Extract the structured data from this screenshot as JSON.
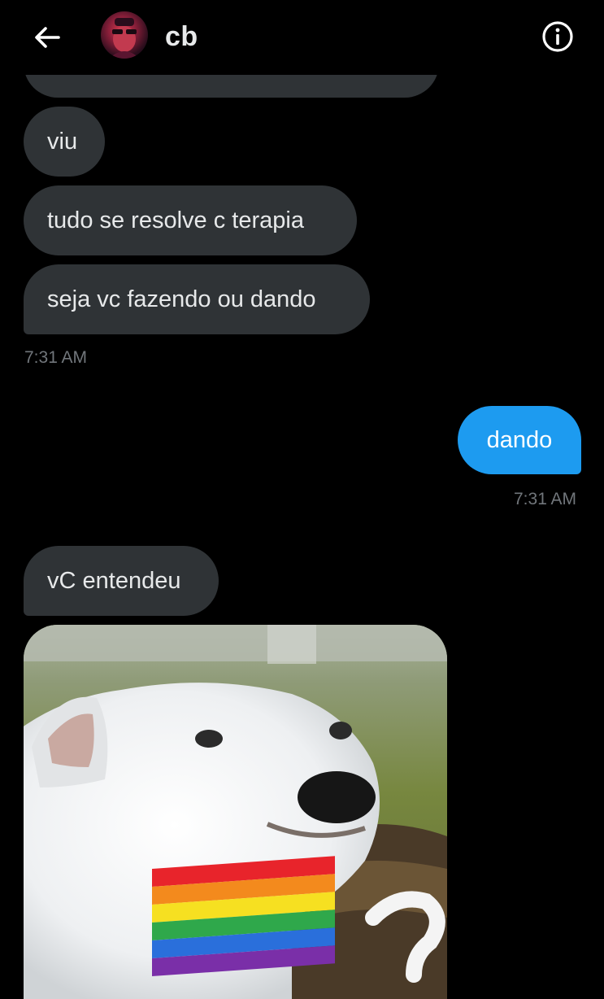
{
  "header": {
    "contact_name": "cb",
    "back_icon": "arrow-left-icon",
    "info_icon": "info-icon"
  },
  "messages": [
    {
      "sender": "them",
      "text": "viu"
    },
    {
      "sender": "them",
      "text": "tudo se resolve c terapia"
    },
    {
      "sender": "them",
      "text": "seja vc fazendo ou dando"
    },
    {
      "sender": "me",
      "text": "dando"
    },
    {
      "sender": "them",
      "text": "vC entendeu"
    }
  ],
  "timestamps": {
    "incoming_group": "7:31 AM",
    "outgoing": "7:31 AM"
  },
  "media": {
    "description_icon": "dog-with-rainbow-flag-image"
  },
  "colors": {
    "background": "#000000",
    "incoming_bubble": "#2f3336",
    "outgoing_bubble": "#1d9bf0",
    "text": "#e7e9ea",
    "muted": "#71767b"
  }
}
